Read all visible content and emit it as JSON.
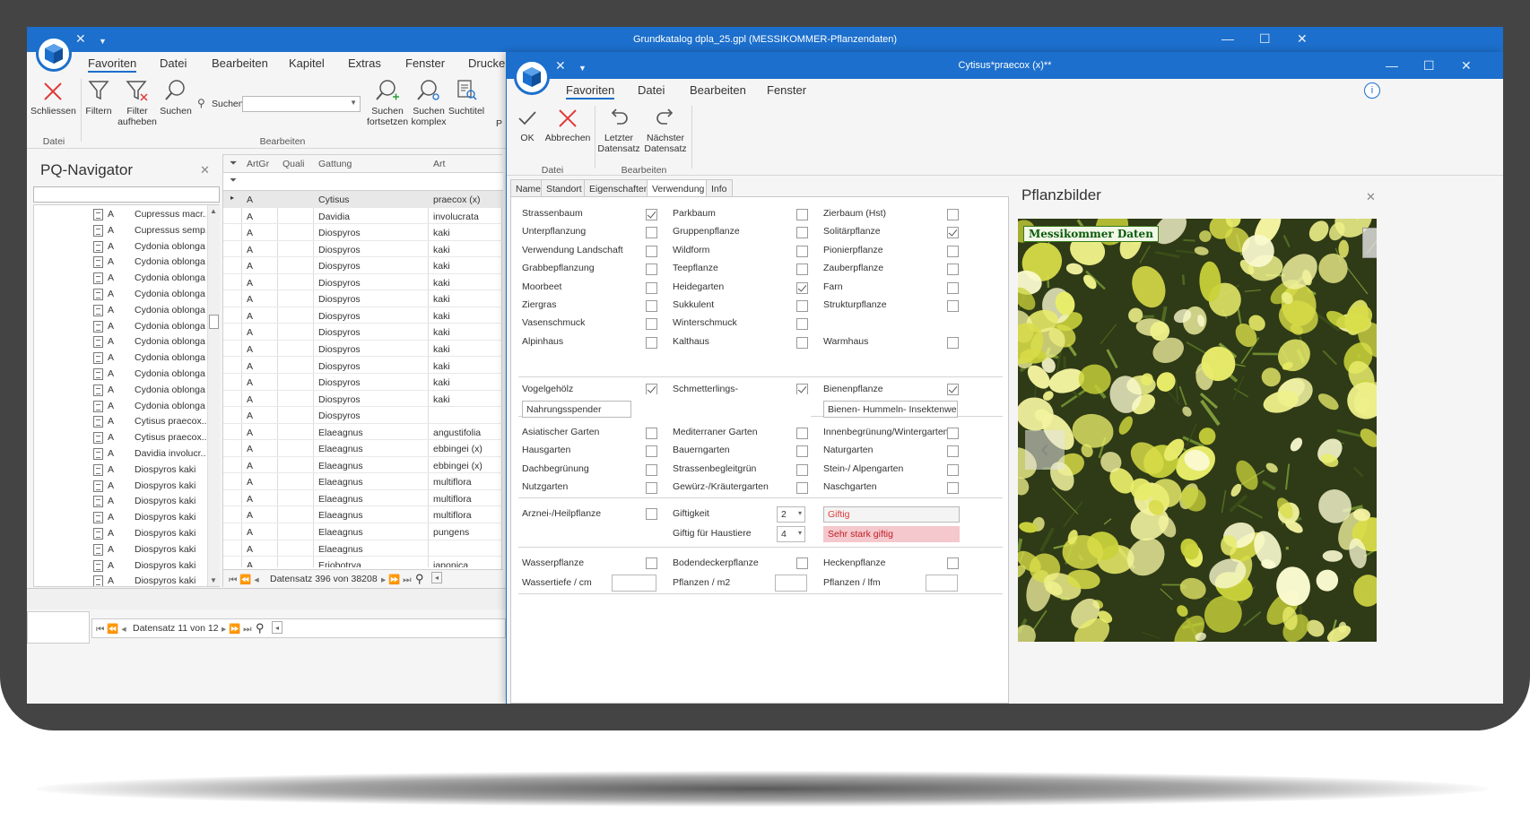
{
  "main_window": {
    "title": "Grundkatalog dpla_25.gpl (MESSIKOMMER-Pflanzendaten)",
    "menu": [
      "Favoriten",
      "Datei",
      "Bearbeiten",
      "Kapitel",
      "Extras",
      "Fenster",
      "Drucke"
    ],
    "ribbon": {
      "close": "Schliessen",
      "filter": "Filtern",
      "filter_off": "Filter aufheben",
      "search": "Suchen",
      "search_label": "Suchen",
      "search_value": "",
      "search_next": "Suchen fortsetzen",
      "search_complex": "Suchen komplex",
      "search_title": "Suchtitel",
      "group_datei": "Datei",
      "group_bearbeiten": "Bearbeiten",
      "cut_label": "P"
    },
    "navigator": {
      "title": "PQ-Navigator",
      "filter_value": "",
      "items": [
        {
          "code": "A",
          "name": "Cupressus macr..."
        },
        {
          "code": "A",
          "name": "Cupressus semp..."
        },
        {
          "code": "A",
          "name": "Cydonia oblonga"
        },
        {
          "code": "A",
          "name": "Cydonia oblonga"
        },
        {
          "code": "A",
          "name": "Cydonia oblonga"
        },
        {
          "code": "A",
          "name": "Cydonia oblonga"
        },
        {
          "code": "A",
          "name": "Cydonia oblonga"
        },
        {
          "code": "A",
          "name": "Cydonia oblonga"
        },
        {
          "code": "A",
          "name": "Cydonia oblonga"
        },
        {
          "code": "A",
          "name": "Cydonia oblonga"
        },
        {
          "code": "A",
          "name": "Cydonia oblonga"
        },
        {
          "code": "A",
          "name": "Cydonia oblonga"
        },
        {
          "code": "A",
          "name": "Cydonia oblonga"
        },
        {
          "code": "A",
          "name": "Cytisus praecox..."
        },
        {
          "code": "A",
          "name": "Cytisus praecox..."
        },
        {
          "code": "A",
          "name": "Davidia involucr..."
        },
        {
          "code": "A",
          "name": "Diospyros kaki"
        },
        {
          "code": "A",
          "name": "Diospyros kaki"
        },
        {
          "code": "A",
          "name": "Diospyros kaki"
        },
        {
          "code": "A",
          "name": "Diospyros kaki"
        },
        {
          "code": "A",
          "name": "Diospyros kaki"
        },
        {
          "code": "A",
          "name": "Diospyros kaki"
        },
        {
          "code": "A",
          "name": "Diospyros kaki"
        },
        {
          "code": "A",
          "name": "Diospyros kaki"
        }
      ],
      "pager": "Datensatz 11 von 12"
    },
    "grid": {
      "columns": [
        "ArtGr",
        "Quali",
        "Gattung",
        "Art"
      ],
      "rows": [
        {
          "artgr": "A",
          "quali": "",
          "gattung": "Cytisus",
          "art": "praecox (x)"
        },
        {
          "artgr": "A",
          "quali": "",
          "gattung": "Davidia",
          "art": "involucrata"
        },
        {
          "artgr": "A",
          "quali": "",
          "gattung": "Diospyros",
          "art": "kaki"
        },
        {
          "artgr": "A",
          "quali": "",
          "gattung": "Diospyros",
          "art": "kaki"
        },
        {
          "artgr": "A",
          "quali": "",
          "gattung": "Diospyros",
          "art": "kaki"
        },
        {
          "artgr": "A",
          "quali": "",
          "gattung": "Diospyros",
          "art": "kaki"
        },
        {
          "artgr": "A",
          "quali": "",
          "gattung": "Diospyros",
          "art": "kaki"
        },
        {
          "artgr": "A",
          "quali": "",
          "gattung": "Diospyros",
          "art": "kaki"
        },
        {
          "artgr": "A",
          "quali": "",
          "gattung": "Diospyros",
          "art": "kaki"
        },
        {
          "artgr": "A",
          "quali": "",
          "gattung": "Diospyros",
          "art": "kaki"
        },
        {
          "artgr": "A",
          "quali": "",
          "gattung": "Diospyros",
          "art": "kaki"
        },
        {
          "artgr": "A",
          "quali": "",
          "gattung": "Diospyros",
          "art": "kaki"
        },
        {
          "artgr": "A",
          "quali": "",
          "gattung": "Diospyros",
          "art": "kaki"
        },
        {
          "artgr": "A",
          "quali": "",
          "gattung": "Diospyros",
          "art": ""
        },
        {
          "artgr": "A",
          "quali": "",
          "gattung": "Elaeagnus",
          "art": "angustifolia"
        },
        {
          "artgr": "A",
          "quali": "",
          "gattung": "Elaeagnus",
          "art": "ebbingei (x)"
        },
        {
          "artgr": "A",
          "quali": "",
          "gattung": "Elaeagnus",
          "art": "ebbingei (x)"
        },
        {
          "artgr": "A",
          "quali": "",
          "gattung": "Elaeagnus",
          "art": "multiflora"
        },
        {
          "artgr": "A",
          "quali": "",
          "gattung": "Elaeagnus",
          "art": "multiflora"
        },
        {
          "artgr": "A",
          "quali": "",
          "gattung": "Elaeagnus",
          "art": "multiflora"
        },
        {
          "artgr": "A",
          "quali": "",
          "gattung": "Elaeagnus",
          "art": "pungens"
        },
        {
          "artgr": "A",
          "quali": "",
          "gattung": "Elaeagnus",
          "art": ""
        },
        {
          "artgr": "A",
          "quali": "",
          "gattung": "Eriobotrya",
          "art": "japonica"
        }
      ],
      "pager": "Datensatz 396 von 38208"
    }
  },
  "detail_window": {
    "title": "Cytisus*praecox (x)**",
    "menu": [
      "Favoriten",
      "Datei",
      "Bearbeiten",
      "Fenster"
    ],
    "ribbon": {
      "ok": "OK",
      "cancel": "Abbrechen",
      "prev": "Letzter Datensatz",
      "next": "Nächster Datensatz",
      "group_datei": "Datei",
      "group_bearbeiten": "Bearbeiten"
    },
    "tabs": [
      "Name",
      "Standort",
      "Eigenschaften",
      "Verwendung",
      "Info"
    ],
    "selected_tab": "Verwendung",
    "checks_col1": [
      {
        "label": "Strassenbaum",
        "checked": true
      },
      {
        "label": "Unterpflanzung",
        "checked": false
      },
      {
        "label": "Verwendung Landschaft",
        "checked": false
      },
      {
        "label": "Grabbepflanzung",
        "checked": false
      },
      {
        "label": "Moorbeet",
        "checked": false
      },
      {
        "label": "Ziergras",
        "checked": false
      },
      {
        "label": "Vasenschmuck",
        "checked": false
      },
      {
        "label": "Alpinhaus",
        "checked": false
      }
    ],
    "checks_col2": [
      {
        "label": "Parkbaum",
        "checked": false
      },
      {
        "label": "Gruppenpflanze",
        "checked": false
      },
      {
        "label": "Wildform",
        "checked": false
      },
      {
        "label": "Teepflanze",
        "checked": false
      },
      {
        "label": "Heidegarten",
        "checked": true
      },
      {
        "label": "Sukkulent",
        "checked": false
      },
      {
        "label": "Winterschmuck",
        "checked": false
      },
      {
        "label": "Kalthaus",
        "checked": false
      }
    ],
    "checks_col3": [
      {
        "label": "Zierbaum (Hst)",
        "checked": false
      },
      {
        "label": "Solitärpflanze",
        "checked": true
      },
      {
        "label": "Pionierpflanze",
        "checked": false
      },
      {
        "label": "Zauberpflanze",
        "checked": false
      },
      {
        "label": "Farn",
        "checked": false
      },
      {
        "label": "Strukturpflanze",
        "checked": false
      },
      {
        "label": "",
        "checked": null
      },
      {
        "label": "Warmhaus",
        "checked": false
      }
    ],
    "vogel": {
      "label": "Vogelgehölz",
      "checked": true,
      "value": "Nahrungsspender"
    },
    "schmetterling": {
      "label": "Schmetterlings-",
      "checked": true
    },
    "biene": {
      "label": "Bienenpflanze",
      "checked": true,
      "value": "Bienen- Hummeln- Insektenweide"
    },
    "garden_col1": [
      {
        "label": "Asiatischer Garten",
        "checked": false
      },
      {
        "label": "Hausgarten",
        "checked": false
      },
      {
        "label": "Dachbegrünung",
        "checked": false
      },
      {
        "label": "Nutzgarten",
        "checked": false
      }
    ],
    "garden_col2": [
      {
        "label": "Mediterraner Garten",
        "checked": false
      },
      {
        "label": "Bauerngarten",
        "checked": false
      },
      {
        "label": "Strassenbegleitgrün",
        "checked": false
      },
      {
        "label": "Gewürz-/Kräutergarten",
        "checked": false
      }
    ],
    "garden_col3": [
      {
        "label": "Innenbegrünung/Wintergarten",
        "checked": false
      },
      {
        "label": "Naturgarten",
        "checked": false
      },
      {
        "label": "Stein-/ Alpengarten",
        "checked": false
      },
      {
        "label": "Naschgarten",
        "checked": false
      }
    ],
    "arznei": {
      "label": "Arznei-/Heilpflanze",
      "checked": false
    },
    "gift": {
      "label": "Giftigkeit",
      "value": "2",
      "text": "Giftig"
    },
    "gift_tier": {
      "label": "Giftig für Haustiere",
      "value": "4",
      "text": "Sehr stark giftig"
    },
    "bottom": {
      "wasser": "Wasserpflanze",
      "boden": "Bodendeckerpflanze",
      "hecke": "Heckenpflanze",
      "wassertiefe": "Wassertiefe / cm",
      "pflanzen_m2": "Pflanzen / m2",
      "pflanzen_lfm": "Pflanzen / lfm"
    },
    "bilder": {
      "title": "Pflanzbilder",
      "badge": "Messikommer Daten"
    },
    "colors": {
      "accent": "#1c6fcc",
      "danger": "#e03a3a",
      "warn_bg": "#f4c8cc"
    }
  }
}
